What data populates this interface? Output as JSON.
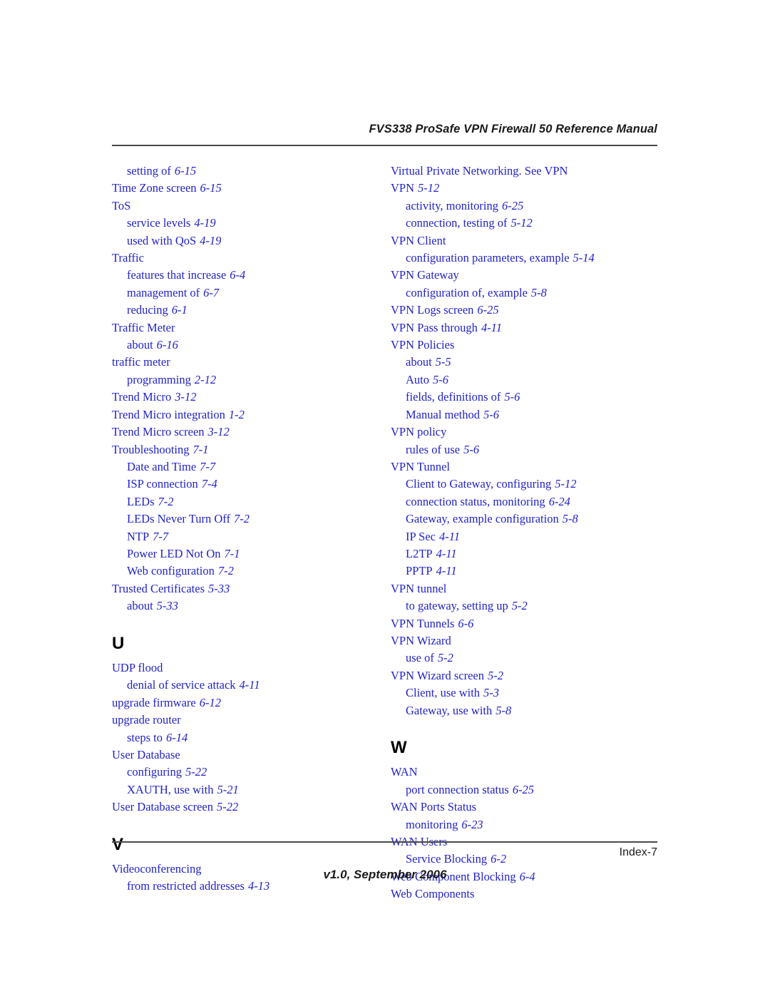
{
  "header": {
    "title": "FVS338 ProSafe VPN Firewall 50 Reference Manual"
  },
  "footer": {
    "folio": "Index-7",
    "version": "v1.0, September 2006"
  },
  "columns": {
    "left": [
      {
        "kind": "entry",
        "level": 2,
        "term": "setting of",
        "page": "6-15"
      },
      {
        "kind": "entry",
        "level": 1,
        "term": "Time Zone screen",
        "page": "6-15"
      },
      {
        "kind": "entry",
        "level": 1,
        "term": "ToS",
        "page": ""
      },
      {
        "kind": "entry",
        "level": 2,
        "term": "service levels",
        "page": "4-19"
      },
      {
        "kind": "entry",
        "level": 2,
        "term": "used with QoS",
        "page": "4-19"
      },
      {
        "kind": "entry",
        "level": 1,
        "term": "Traffic",
        "page": ""
      },
      {
        "kind": "entry",
        "level": 2,
        "term": "features that increase",
        "page": "6-4"
      },
      {
        "kind": "entry",
        "level": 2,
        "term": "management of",
        "page": "6-7"
      },
      {
        "kind": "entry",
        "level": 2,
        "term": "reducing",
        "page": "6-1"
      },
      {
        "kind": "entry",
        "level": 1,
        "term": "Traffic Meter",
        "page": ""
      },
      {
        "kind": "entry",
        "level": 2,
        "term": "about",
        "page": "6-16"
      },
      {
        "kind": "entry",
        "level": 1,
        "term": "traffic meter",
        "page": ""
      },
      {
        "kind": "entry",
        "level": 2,
        "term": "programming",
        "page": "2-12"
      },
      {
        "kind": "entry",
        "level": 1,
        "term": "Trend Micro",
        "page": "3-12"
      },
      {
        "kind": "entry",
        "level": 1,
        "term": "Trend Micro integration",
        "page": "1-2"
      },
      {
        "kind": "entry",
        "level": 1,
        "term": "Trend Micro screen",
        "page": "3-12"
      },
      {
        "kind": "entry",
        "level": 1,
        "term": "Troubleshooting",
        "page": "7-1"
      },
      {
        "kind": "entry",
        "level": 2,
        "term": "Date and Time",
        "page": "7-7"
      },
      {
        "kind": "entry",
        "level": 2,
        "term": "ISP connection",
        "page": "7-4"
      },
      {
        "kind": "entry",
        "level": 2,
        "term": "LEDs",
        "page": "7-2"
      },
      {
        "kind": "entry",
        "level": 2,
        "term": "LEDs Never Turn Off",
        "page": "7-2"
      },
      {
        "kind": "entry",
        "level": 2,
        "term": "NTP",
        "page": "7-7"
      },
      {
        "kind": "entry",
        "level": 2,
        "term": "Power LED Not On",
        "page": "7-1"
      },
      {
        "kind": "entry",
        "level": 2,
        "term": "Web configuration",
        "page": "7-2"
      },
      {
        "kind": "entry",
        "level": 1,
        "term": "Trusted Certificates",
        "page": "5-33"
      },
      {
        "kind": "entry",
        "level": 2,
        "term": "about",
        "page": "5-33"
      },
      {
        "kind": "letter",
        "letter": "U"
      },
      {
        "kind": "entry",
        "level": 1,
        "term": "UDP flood",
        "page": ""
      },
      {
        "kind": "entry",
        "level": 2,
        "term": "denial of service attack",
        "page": "4-11"
      },
      {
        "kind": "entry",
        "level": 1,
        "term": "upgrade firmware",
        "page": "6-12"
      },
      {
        "kind": "entry",
        "level": 1,
        "term": "upgrade router",
        "page": ""
      },
      {
        "kind": "entry",
        "level": 2,
        "term": "steps to",
        "page": "6-14"
      },
      {
        "kind": "entry",
        "level": 1,
        "term": "User Database",
        "page": ""
      },
      {
        "kind": "entry",
        "level": 2,
        "term": "configuring",
        "page": "5-22"
      },
      {
        "kind": "entry",
        "level": 2,
        "term": "XAUTH, use with",
        "page": "5-21"
      },
      {
        "kind": "entry",
        "level": 1,
        "term": "User Database screen",
        "page": "5-22"
      },
      {
        "kind": "letter",
        "letter": "V"
      },
      {
        "kind": "entry",
        "level": 1,
        "term": "Videoconferencing",
        "page": ""
      },
      {
        "kind": "entry",
        "level": 2,
        "term": "from restricted addresses",
        "page": "4-13"
      }
    ],
    "right": [
      {
        "kind": "entry",
        "level": 1,
        "term": "Virtual Private Networking. See VPN",
        "page": ""
      },
      {
        "kind": "entry",
        "level": 1,
        "term": "VPN",
        "page": "5-12"
      },
      {
        "kind": "entry",
        "level": 2,
        "term": "activity, monitoring",
        "page": "6-25"
      },
      {
        "kind": "entry",
        "level": 2,
        "term": "connection, testing of",
        "page": "5-12"
      },
      {
        "kind": "entry",
        "level": 1,
        "term": "VPN Client",
        "page": ""
      },
      {
        "kind": "entry",
        "level": 2,
        "term": "configuration parameters, example",
        "page": "5-14"
      },
      {
        "kind": "entry",
        "level": 1,
        "term": "VPN Gateway",
        "page": ""
      },
      {
        "kind": "entry",
        "level": 2,
        "term": "configuration of, example",
        "page": "5-8"
      },
      {
        "kind": "entry",
        "level": 1,
        "term": "VPN Logs screen",
        "page": "6-25"
      },
      {
        "kind": "entry",
        "level": 1,
        "term": "VPN Pass through",
        "page": "4-11"
      },
      {
        "kind": "entry",
        "level": 1,
        "term": "VPN Policies",
        "page": ""
      },
      {
        "kind": "entry",
        "level": 2,
        "term": "about",
        "page": "5-5"
      },
      {
        "kind": "entry",
        "level": 2,
        "term": "Auto",
        "page": "5-6"
      },
      {
        "kind": "entry",
        "level": 2,
        "term": "fields, definitions of",
        "page": "5-6"
      },
      {
        "kind": "entry",
        "level": 2,
        "term": "Manual method",
        "page": "5-6"
      },
      {
        "kind": "entry",
        "level": 1,
        "term": "VPN policy",
        "page": ""
      },
      {
        "kind": "entry",
        "level": 2,
        "term": "rules of use",
        "page": "5-6"
      },
      {
        "kind": "entry",
        "level": 1,
        "term": "VPN Tunnel",
        "page": ""
      },
      {
        "kind": "entry",
        "level": 2,
        "term": "Client to Gateway, configuring",
        "page": "5-12"
      },
      {
        "kind": "entry",
        "level": 2,
        "term": "connection status, monitoring",
        "page": "6-24"
      },
      {
        "kind": "entry",
        "level": 2,
        "term": "Gateway, example configuration",
        "page": "5-8"
      },
      {
        "kind": "entry",
        "level": 2,
        "term": "IP Sec",
        "page": "4-11"
      },
      {
        "kind": "entry",
        "level": 2,
        "term": "L2TP",
        "page": "4-11"
      },
      {
        "kind": "entry",
        "level": 2,
        "term": "PPTP",
        "page": "4-11"
      },
      {
        "kind": "entry",
        "level": 1,
        "term": "VPN tunnel",
        "page": ""
      },
      {
        "kind": "entry",
        "level": 2,
        "term": "to gateway, setting up",
        "page": "5-2"
      },
      {
        "kind": "entry",
        "level": 1,
        "term": "VPN Tunnels",
        "page": "6-6"
      },
      {
        "kind": "entry",
        "level": 1,
        "term": "VPN Wizard",
        "page": ""
      },
      {
        "kind": "entry",
        "level": 2,
        "term": "use of",
        "page": "5-2"
      },
      {
        "kind": "entry",
        "level": 1,
        "term": "VPN Wizard screen",
        "page": "5-2"
      },
      {
        "kind": "entry",
        "level": 2,
        "term": "Client, use with",
        "page": "5-3"
      },
      {
        "kind": "entry",
        "level": 2,
        "term": "Gateway, use with",
        "page": "5-8"
      },
      {
        "kind": "letter",
        "letter": "W"
      },
      {
        "kind": "entry",
        "level": 1,
        "term": "WAN",
        "page": ""
      },
      {
        "kind": "entry",
        "level": 2,
        "term": "port connection status",
        "page": "6-25"
      },
      {
        "kind": "entry",
        "level": 1,
        "term": "WAN Ports Status",
        "page": ""
      },
      {
        "kind": "entry",
        "level": 2,
        "term": "monitoring",
        "page": "6-23"
      },
      {
        "kind": "entry",
        "level": 1,
        "term": "WAN Users",
        "page": ""
      },
      {
        "kind": "entry",
        "level": 2,
        "term": "Service Blocking",
        "page": "6-2"
      },
      {
        "kind": "entry",
        "level": 1,
        "term": "Web Component Blocking",
        "page": "6-4"
      },
      {
        "kind": "entry",
        "level": 1,
        "term": "Web Components",
        "page": ""
      }
    ]
  },
  "colors": {
    "entry_text": "#2222cc",
    "heading_text": "#000000",
    "rule": "#4a4a4a"
  }
}
